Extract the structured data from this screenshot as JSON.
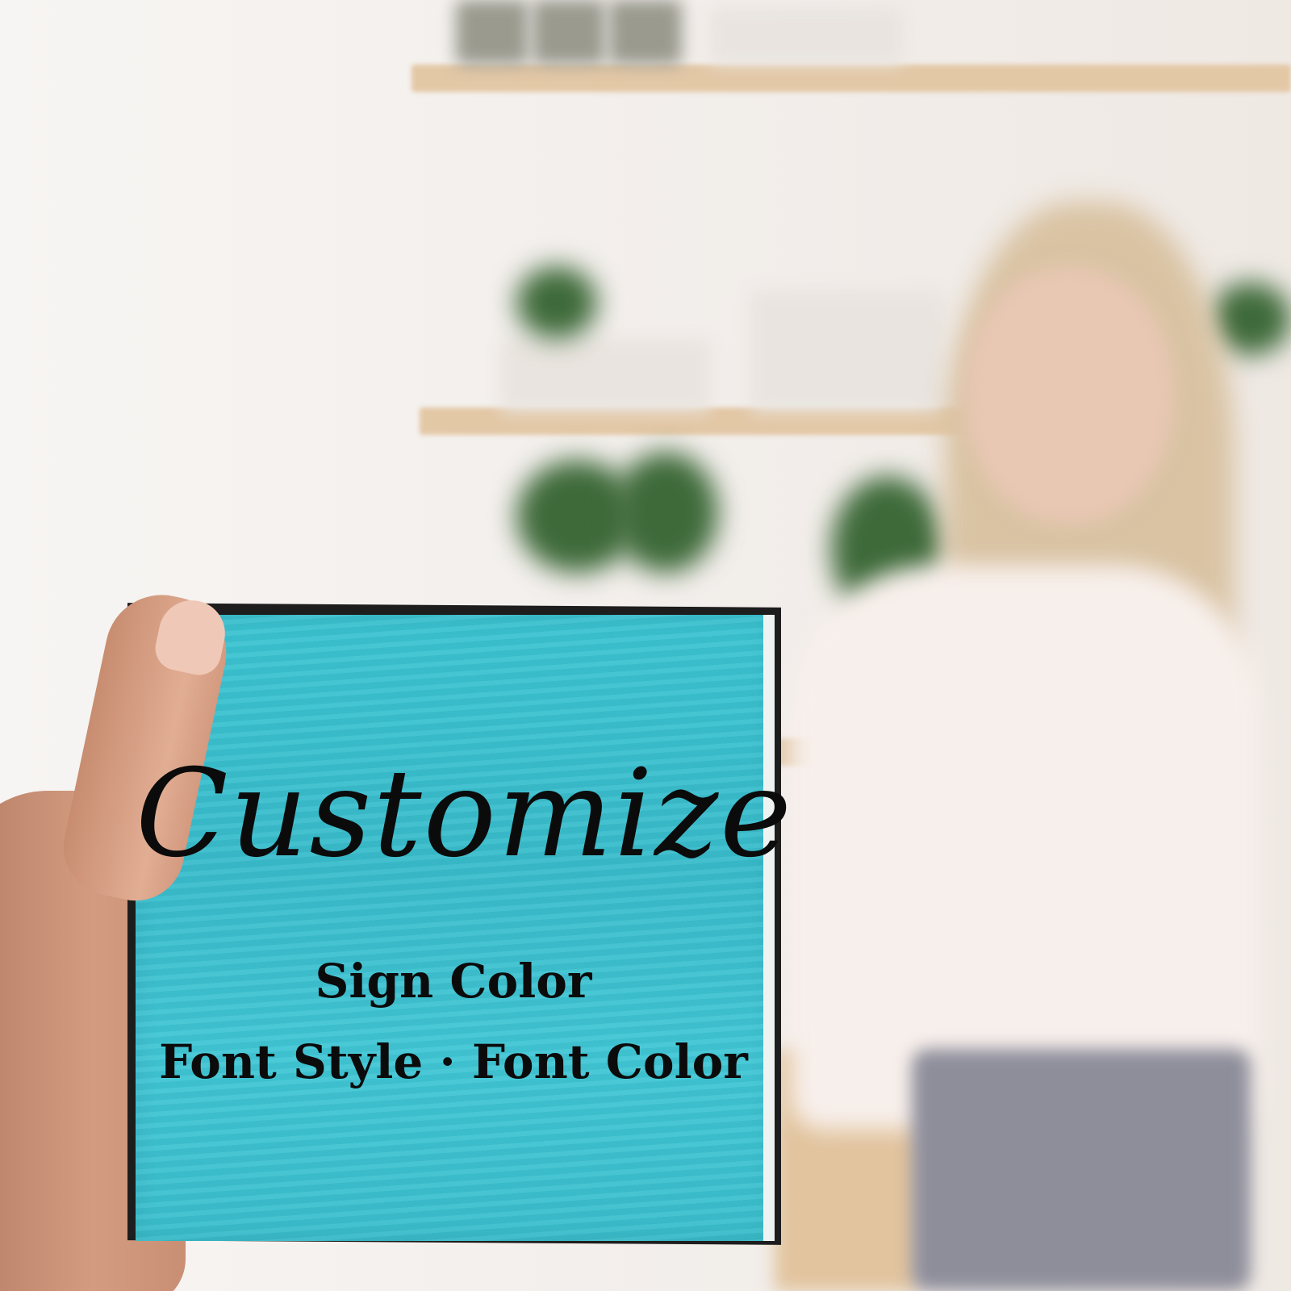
{
  "sign": {
    "title": "Customize",
    "line1": "Sign Color",
    "line2": "Font Style · Font Color",
    "color": "#3cc4d2",
    "text_color": "#0b0b0b"
  },
  "scene": {
    "background": "kitchen with blurred shelves, plants and a woman",
    "hand": "hand holding the sign"
  }
}
